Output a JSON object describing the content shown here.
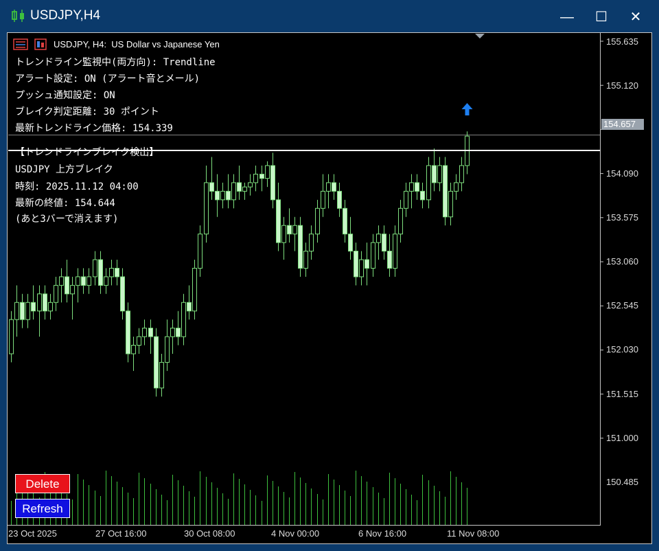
{
  "window": {
    "title": "USDJPY,H4",
    "minimize_glyph": "—",
    "maximize_glyph": "☐",
    "close_glyph": "✕"
  },
  "chart_header": {
    "text": "USDJPY, H4:  US Dollar vs Japanese Yen"
  },
  "info_panel": {
    "line1": "トレンドライン監視中(両方向): Trendline",
    "line2": "アラート設定: ON (アラート音とメール)",
    "line3": "プッシュ通知設定: ON",
    "line4": "ブレイク判定距離: 30 ポイント",
    "line5": "最新トレンドライン価格: 154.339"
  },
  "break_panel": {
    "line1": "【トレンドラインブレイク検出】",
    "line2": "USDJPY 上方ブレイク",
    "line3": "時刻: 2025.11.12 04:00",
    "line4": "最新の終値: 154.644",
    "line5": "(あと3バーで消えます)"
  },
  "buttons": {
    "delete_label": "Delete",
    "refresh_label": "Refresh",
    "delete_color": "#e8131b",
    "refresh_color": "#1010e0"
  },
  "price_axis": {
    "labels": [
      "155.635",
      "155.120",
      "154.090",
      "153.575",
      "153.060",
      "152.545",
      "152.030",
      "151.515",
      "151.000",
      "150.485"
    ],
    "current_price": "154.657"
  },
  "time_axis": {
    "labels": [
      "23 Oct 2025",
      "27 Oct 16:00",
      "30 Oct 08:00",
      "4 Nov 00:00",
      "6 Nov 16:00",
      "11 Nov 08:00"
    ]
  },
  "colors": {
    "background": "#000000",
    "candle_up_fill": "#000000",
    "candle_bull": "#7fe07f",
    "candle_bear_fill": "#c8f5c8",
    "volume": "#3ec03e",
    "arrow": "#1e7ff0",
    "frame": "#0b3a6b"
  },
  "chart_data": {
    "type": "candlestick",
    "symbol": "USDJPY",
    "timeframe": "H4",
    "ylim": [
      150.1,
      155.85
    ],
    "trendline_price": 154.339,
    "current_price": 154.657,
    "signal": "up-arrow",
    "ohlc": [
      [
        152.1,
        152.6,
        152.0,
        152.5
      ],
      [
        152.5,
        152.9,
        152.3,
        152.7
      ],
      [
        152.7,
        152.8,
        152.4,
        152.5
      ],
      [
        152.5,
        152.8,
        152.4,
        152.7
      ],
      [
        152.7,
        152.9,
        152.5,
        152.6
      ],
      [
        152.6,
        152.9,
        152.3,
        152.8
      ],
      [
        152.8,
        152.9,
        152.5,
        152.6
      ],
      [
        152.6,
        152.8,
        152.5,
        152.7
      ],
      [
        152.7,
        153.0,
        152.6,
        152.9
      ],
      [
        152.9,
        153.1,
        152.7,
        153.0
      ],
      [
        153.0,
        153.2,
        152.7,
        152.8
      ],
      [
        152.8,
        153.0,
        152.5,
        152.9
      ],
      [
        152.9,
        153.1,
        152.7,
        153.0
      ],
      [
        153.0,
        153.1,
        152.8,
        152.9
      ],
      [
        152.9,
        153.1,
        152.8,
        153.0
      ],
      [
        153.0,
        153.3,
        152.9,
        153.2
      ],
      [
        153.2,
        153.3,
        152.8,
        152.9
      ],
      [
        152.9,
        153.1,
        152.8,
        153.0
      ],
      [
        153.0,
        153.2,
        152.9,
        153.1
      ],
      [
        153.1,
        153.2,
        152.9,
        153.0
      ],
      [
        153.0,
        153.1,
        152.5,
        152.6
      ],
      [
        152.6,
        152.7,
        152.0,
        152.1
      ],
      [
        152.1,
        152.3,
        151.9,
        152.2
      ],
      [
        152.2,
        152.4,
        152.1,
        152.3
      ],
      [
        152.3,
        152.5,
        152.2,
        152.4
      ],
      [
        152.4,
        152.5,
        152.1,
        152.3
      ],
      [
        152.3,
        152.4,
        151.6,
        151.7
      ],
      [
        151.7,
        152.1,
        151.6,
        152.0
      ],
      [
        152.0,
        152.5,
        151.9,
        152.3
      ],
      [
        152.3,
        152.5,
        152.1,
        152.4
      ],
      [
        152.4,
        152.6,
        152.2,
        152.3
      ],
      [
        152.3,
        152.8,
        152.2,
        152.7
      ],
      [
        152.7,
        152.9,
        152.5,
        152.6
      ],
      [
        152.6,
        153.2,
        152.5,
        153.1
      ],
      [
        153.1,
        153.6,
        153.0,
        153.5
      ],
      [
        153.5,
        154.3,
        153.4,
        154.1
      ],
      [
        154.1,
        154.4,
        153.9,
        154.0
      ],
      [
        154.0,
        154.2,
        153.7,
        153.9
      ],
      [
        153.9,
        154.1,
        153.8,
        154.0
      ],
      [
        154.0,
        154.2,
        153.8,
        153.9
      ],
      [
        153.9,
        154.2,
        153.8,
        154.1
      ],
      [
        154.1,
        154.3,
        153.9,
        154.0
      ],
      [
        154.0,
        154.1,
        153.9,
        154.05
      ],
      [
        154.05,
        154.2,
        153.95,
        154.1
      ],
      [
        154.1,
        154.3,
        154.0,
        154.2
      ],
      [
        154.2,
        154.3,
        154.0,
        154.15
      ],
      [
        154.15,
        154.35,
        154.05,
        154.3
      ],
      [
        154.3,
        154.45,
        153.8,
        153.9
      ],
      [
        153.9,
        154.1,
        153.3,
        153.4
      ],
      [
        153.4,
        153.7,
        153.2,
        153.6
      ],
      [
        153.6,
        153.8,
        153.4,
        153.5
      ],
      [
        153.5,
        153.7,
        153.3,
        153.6
      ],
      [
        153.6,
        153.7,
        153.0,
        153.1
      ],
      [
        153.1,
        153.4,
        153.0,
        153.3
      ],
      [
        153.3,
        153.6,
        153.2,
        153.5
      ],
      [
        153.5,
        153.9,
        153.4,
        153.8
      ],
      [
        153.8,
        154.2,
        153.7,
        154.0
      ],
      [
        154.0,
        154.2,
        153.8,
        154.1
      ],
      [
        154.1,
        154.2,
        153.9,
        154.0
      ],
      [
        154.0,
        154.1,
        153.7,
        153.8
      ],
      [
        153.8,
        153.9,
        153.4,
        153.5
      ],
      [
        153.5,
        153.7,
        153.2,
        153.3
      ],
      [
        153.3,
        153.4,
        152.9,
        153.0
      ],
      [
        153.0,
        153.3,
        152.9,
        153.2
      ],
      [
        153.2,
        153.4,
        152.9,
        153.1
      ],
      [
        153.1,
        153.5,
        153.0,
        153.4
      ],
      [
        153.4,
        153.6,
        153.2,
        153.5
      ],
      [
        153.5,
        153.6,
        153.2,
        153.3
      ],
      [
        153.3,
        153.5,
        153.0,
        153.1
      ],
      [
        153.1,
        153.6,
        153.0,
        153.5
      ],
      [
        153.5,
        153.9,
        153.4,
        153.8
      ],
      [
        153.8,
        154.1,
        153.7,
        154.0
      ],
      [
        154.0,
        154.2,
        153.8,
        154.1
      ],
      [
        154.1,
        154.2,
        153.9,
        154.0
      ],
      [
        154.0,
        154.1,
        153.8,
        153.9
      ],
      [
        153.9,
        154.4,
        153.8,
        154.3
      ],
      [
        154.3,
        154.5,
        154.0,
        154.1
      ],
      [
        154.1,
        154.4,
        154.0,
        154.3
      ],
      [
        154.3,
        154.4,
        153.6,
        153.7
      ],
      [
        153.7,
        154.1,
        153.6,
        154.0
      ],
      [
        154.0,
        154.2,
        153.9,
        154.1
      ],
      [
        154.1,
        154.4,
        154.0,
        154.3
      ],
      [
        154.3,
        154.7,
        154.2,
        154.644
      ]
    ]
  }
}
